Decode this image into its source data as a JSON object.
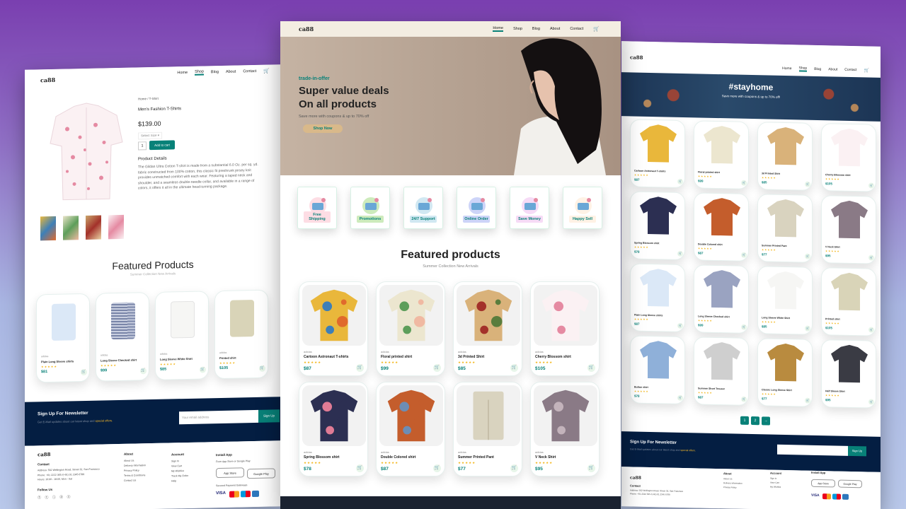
{
  "site": {
    "logo": "ca88",
    "cart_icon": "cart-icon"
  },
  "nav": [
    "Home",
    "Shop",
    "Blog",
    "About",
    "Contact"
  ],
  "center": {
    "hero": {
      "kicker": "trade-in-offer",
      "title1": "Super value deals",
      "title2": "On all products",
      "sub": "Save more with coupons & up to 70% off",
      "cta": "Shop Now"
    },
    "features": [
      {
        "label": "Free Shipping",
        "color": "#fddde4"
      },
      {
        "label": "Promotions",
        "color": "#cdebbc"
      },
      {
        "label": "24/7 Support",
        "color": "#d1e8f2"
      },
      {
        "label": "Online Order",
        "color": "#cdd4f8"
      },
      {
        "label": "Save Money",
        "color": "#f6dbf6"
      },
      {
        "label": "Happy Sell",
        "color": "#fff2e5"
      }
    ],
    "section_title": "Featured products",
    "section_sub": "Summer Collection New Arrivals",
    "products": [
      {
        "brand": "adidas",
        "name": "Cartoon Astronaut T-shirts",
        "stars": "★★★★★",
        "price": "$87"
      },
      {
        "brand": "adidas",
        "name": "Floral printed shirt",
        "stars": "★★★★★",
        "price": "$99"
      },
      {
        "brand": "adidas",
        "name": "3d Printed Shirt",
        "stars": "★★★★★",
        "price": "$85"
      },
      {
        "brand": "adidas",
        "name": "Cherry Blossom shirt",
        "stars": "★★★★★",
        "price": "$105"
      },
      {
        "brand": "adidas",
        "name": "Spring Blossom shirt",
        "stars": "★★★★★",
        "price": "$78"
      },
      {
        "brand": "adidas",
        "name": "Double Colored shirt",
        "stars": "★★★★★",
        "price": "$87"
      },
      {
        "brand": "adidas",
        "name": "Summer Printed Pant",
        "stars": "★★★★★",
        "price": "$77"
      },
      {
        "brand": "adidas",
        "name": "V Neck Shirt",
        "stars": "★★★★★",
        "price": "$95"
      }
    ]
  },
  "left": {
    "breadcrumb": "Home / T-Shirt",
    "product_name": "Men's Fashion T-Shirts",
    "price": "$139.00",
    "select": "Select Size",
    "qty": "1",
    "add_to_cart": "Add to cart",
    "details_title": "Product Details",
    "details": "The Gildan Ultra Cotton T-shirt is made from a substantial 6.0 Oz. per sq. yd. fabric constructed from 100% cotton, this classic fit preshrunk jersey knit provides unmatched comfort with each wear. Featuring a taped neck and shoulder, and a seamless double-needle collar, and available in a range of colors, it offers it all in the ultimate head-turning package.",
    "section_title": "Featured Products",
    "section_sub": "Summer Collection New Arrivals",
    "products": [
      {
        "brand": "adidas",
        "name": "Plain Long Sleeve shirts",
        "stars": "★★★★★",
        "price": "$81"
      },
      {
        "brand": "adidas",
        "name": "Long Sleeve Checked shirt",
        "stars": "★★★★★",
        "price": "$99"
      },
      {
        "brand": "adidas",
        "name": "Long Sleeve White Shirt",
        "stars": "★★★★★",
        "price": "$85"
      },
      {
        "brand": "adidas",
        "name": "Printed shirt",
        "stars": "★★★★★",
        "price": "$105"
      }
    ],
    "newsletter": {
      "title": "Sign Up For Newsletter",
      "sub": "Get E-Mail updates about our latest shop and ",
      "sub_hl": "special offers.",
      "placeholder": "Your email address",
      "btn": "Sign Up"
    },
    "footer": {
      "contact": "Contact",
      "address": "Address: 562 Wellington Road, Street 32, San Francisco",
      "phone": "Phone: +01 2222 365 /(+91) 01 2345 6789",
      "hours": "Hours: 10:00 - 18:00, Mon - Sat",
      "follow": "Follow Us",
      "about_title": "About",
      "about": [
        "About Us",
        "Delivery Information",
        "Privacy Policy",
        "Terms & Conditions",
        "Contact Us"
      ],
      "account_title": "Account",
      "account": [
        "Sign In",
        "View Cart",
        "My Wishlist",
        "Track My Order",
        "Help"
      ],
      "install_title": "Install App",
      "install_sub": "From App Store or Google Play",
      "appstore": "App Store",
      "googleplay": "Google Play",
      "secured": "Secured Payment Gateways",
      "visa": "VISA"
    }
  },
  "right": {
    "hero_title": "#stayhome",
    "hero_sub": "Save more with coupons & up to 70% off!",
    "products": [
      {
        "name": "Cartoon Astronaut T-shirts",
        "price": "$87"
      },
      {
        "name": "Floral printed shirt",
        "price": "$99"
      },
      {
        "name": "3d Printed Shirt",
        "price": "$85"
      },
      {
        "name": "Cherry Blossom shirt",
        "price": "$105"
      },
      {
        "name": "Spring Blossom shirt",
        "price": "$78"
      },
      {
        "name": "Double Colored shirt",
        "price": "$87"
      },
      {
        "name": "Summer Printed Pant",
        "price": "$77"
      },
      {
        "name": "V Neck Shirt",
        "price": "$95"
      },
      {
        "name": "Plain Long Sleeve shirts",
        "price": "$87"
      },
      {
        "name": "Long Sleeve Checked shirt",
        "price": "$99"
      },
      {
        "name": "Long Sleeve White Shirt",
        "price": "$85"
      },
      {
        "name": "Printed shirt",
        "price": "$105"
      },
      {
        "name": "Button shirt",
        "price": "$78"
      },
      {
        "name": "Summer Short Trouser",
        "price": "$87"
      },
      {
        "name": "Classic Long Sleeve Shirt",
        "price": "$77"
      },
      {
        "name": "Half Sleeve Shirt",
        "price": "$95"
      }
    ],
    "pages": [
      "1",
      "2",
      "→"
    ],
    "newsletter": {
      "title": "Sign Up For Newsletter",
      "sub": "Get E-Mail updates about our latest shop and ",
      "sub_hl": "special offers.",
      "btn": "Sign Up"
    }
  }
}
